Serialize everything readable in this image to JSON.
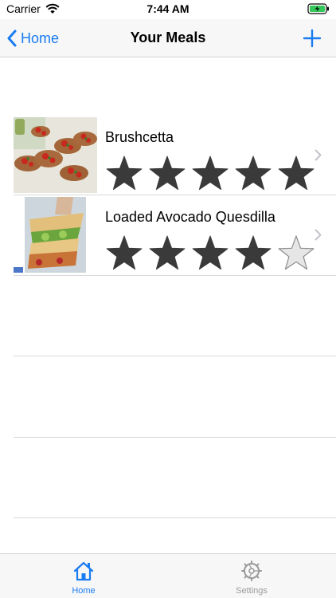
{
  "status_bar": {
    "carrier": "Carrier",
    "time": "7:44 AM"
  },
  "nav": {
    "back_label": "Home",
    "title": "Your Meals"
  },
  "meals": [
    {
      "name": "Brushcetta",
      "rating": 5
    },
    {
      "name": "Loaded Avocado Quesdilla",
      "rating": 4
    }
  ],
  "rating_max": 5,
  "tabs": [
    {
      "label": "Home",
      "icon": "house-icon",
      "selected": true
    },
    {
      "label": "Settings",
      "icon": "gear-icon",
      "selected": false
    }
  ],
  "colors": {
    "accent": "#1a7cf2",
    "star_filled": "#3a3a3a",
    "star_empty": "#e6e6e6",
    "tab_inactive": "#9a9a9a"
  }
}
